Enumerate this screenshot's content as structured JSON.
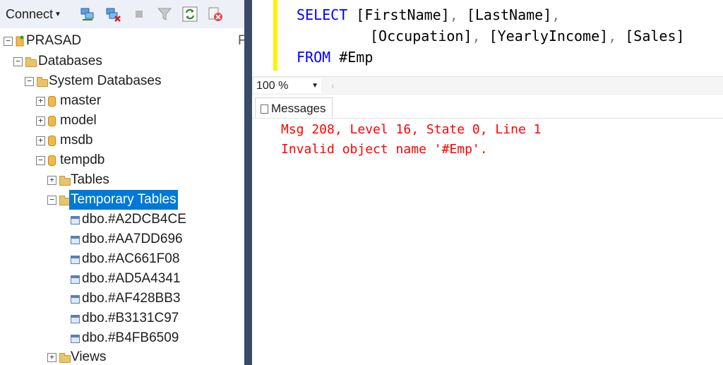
{
  "explorer": {
    "connect_label": "Connect",
    "toolbar_icons": [
      "connect-server-icon",
      "disconnect-server-icon",
      "stop-icon",
      "filter-icon",
      "refresh-icon",
      "collapse-icon"
    ],
    "server_name": "PRASAD",
    "server_suffix": "F",
    "tree": [
      {
        "label": "Databases",
        "expand": "−",
        "icon": "folder-icon"
      },
      {
        "label": "System Databases",
        "expand": "−",
        "icon": "folder-icon"
      },
      {
        "label": "master",
        "expand": "+",
        "icon": "database-icon"
      },
      {
        "label": "model",
        "expand": "+",
        "icon": "database-icon"
      },
      {
        "label": "msdb",
        "expand": "+",
        "icon": "database-icon"
      },
      {
        "label": "tempdb",
        "expand": "−",
        "icon": "database-icon"
      },
      {
        "label": "Tables",
        "expand": "+",
        "icon": "folder-icon"
      },
      {
        "label": "Temporary Tables",
        "expand": "−",
        "icon": "folder-icon",
        "selected": true
      },
      {
        "label": "dbo.#A2DCB4CE",
        "icon": "table-icon"
      },
      {
        "label": "dbo.#AA7DD696",
        "icon": "table-icon"
      },
      {
        "label": "dbo.#AC661F08",
        "icon": "table-icon"
      },
      {
        "label": "dbo.#AD5A4341",
        "icon": "table-icon"
      },
      {
        "label": "dbo.#AF428BB3",
        "icon": "table-icon"
      },
      {
        "label": "dbo.#B3131C97",
        "icon": "table-icon"
      },
      {
        "label": "dbo.#B4FB6509",
        "icon": "table-icon"
      },
      {
        "label": "Views",
        "expand": "+",
        "icon": "folder-icon"
      }
    ]
  },
  "editor": {
    "line1": {
      "kw": "SELECT",
      "c1": "[FirstName]",
      "c2": "[LastName]"
    },
    "line2": {
      "c1": "[Occupation]",
      "c2": "[YearlyIncome]",
      "c3": "[Sales]"
    },
    "line3": {
      "kw": "FROM",
      "rest": "#Emp"
    }
  },
  "zoom": {
    "value": "100 %"
  },
  "results": {
    "tab_label": "Messages",
    "messages": [
      "Msg 208, Level 16, State 0, Line 1",
      "Invalid object name '#Emp'."
    ]
  },
  "colors": {
    "selection": "#0078d7",
    "error": "#ff0000",
    "keyword": "#0000ff",
    "gutter": "#fff200"
  }
}
